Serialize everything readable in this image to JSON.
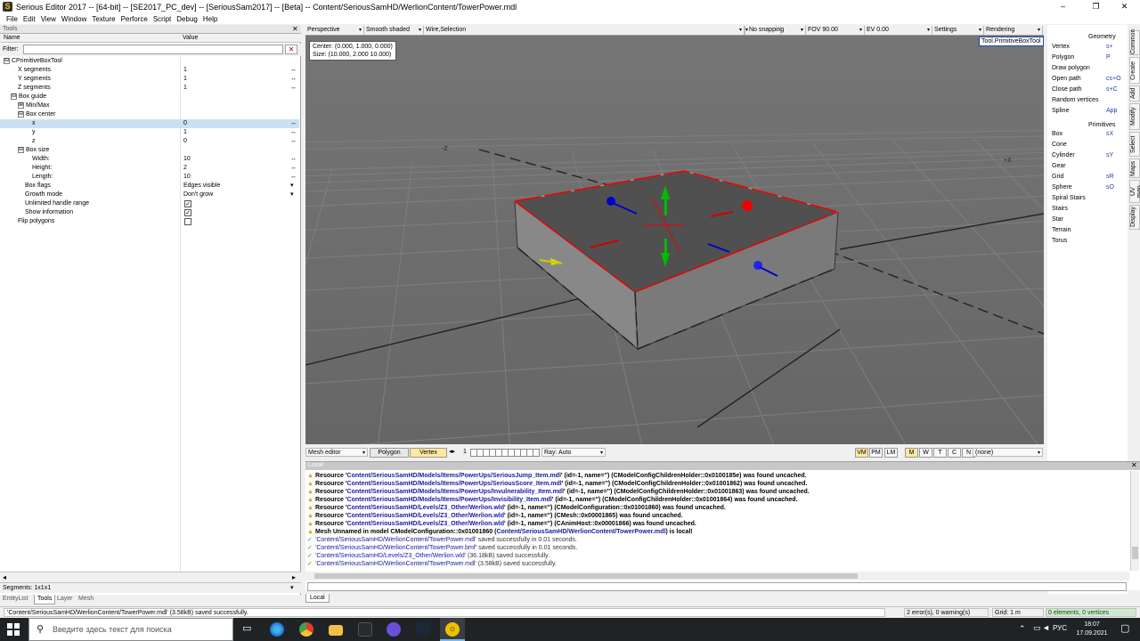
{
  "window": {
    "title": "Serious Editor 2017 -- [64-bit] -- [SE2017_PC_dev] -- [SeriousSam2017] -- [Beta] -- Content/SeriousSamHD/WerlionContent/TowerPower.mdl",
    "minimize": "–",
    "maximize": "❐",
    "close": "✕"
  },
  "menu": [
    "File",
    "Edit",
    "View",
    "Window",
    "Texture",
    "Perforce",
    "Script",
    "Debug",
    "Help"
  ],
  "tools": {
    "title": "Tools",
    "close": "✕",
    "col_name": "Name",
    "col_value": "Value",
    "filter_label": "Filter:",
    "filter_value": "",
    "filter_clear": "✕",
    "rows": [
      {
        "name": "CPrimitiveBoxTool",
        "value": "",
        "exp": "⊟",
        "indent": 0
      },
      {
        "name": "X segments",
        "value": "1",
        "arrow": "↔",
        "indent": 2
      },
      {
        "name": "Y segments",
        "value": "1",
        "arrow": "↔",
        "indent": 2
      },
      {
        "name": "Z segments",
        "value": "1",
        "arrow": "↔",
        "indent": 2
      },
      {
        "name": "Box guide",
        "value": "",
        "exp": "⊟",
        "indent": 1
      },
      {
        "name": "Min/Max",
        "value": "",
        "exp": "⊞",
        "indent": 2
      },
      {
        "name": "Box center",
        "value": "",
        "exp": "⊟",
        "indent": 2
      },
      {
        "name": "x",
        "value": "0",
        "arrow": "↔",
        "indent": 4,
        "sel": true
      },
      {
        "name": "y",
        "value": "1",
        "arrow": "↔",
        "indent": 4
      },
      {
        "name": "z",
        "value": "0",
        "arrow": "↔",
        "indent": 4
      },
      {
        "name": "Box size",
        "value": "",
        "exp": "⊟",
        "indent": 2
      },
      {
        "name": "Width:",
        "value": "10",
        "arrow": "↔",
        "indent": 4
      },
      {
        "name": "Height:",
        "value": "2",
        "arrow": "↔",
        "indent": 4
      },
      {
        "name": "Length:",
        "value": "10",
        "arrow": "↔",
        "indent": 4
      },
      {
        "name": "Box flags",
        "value": "Edges visible",
        "arrow": "▾",
        "indent": 3
      },
      {
        "name": "Growth mode",
        "value": "Don't grow",
        "arrow": "▾",
        "indent": 3
      },
      {
        "name": "Unlimited handle range",
        "value": "",
        "check": true,
        "indent": 3
      },
      {
        "name": "Show information",
        "value": "",
        "check": true,
        "indent": 3
      },
      {
        "name": "Flip polygons",
        "value": "",
        "check": false,
        "indent": 2
      }
    ],
    "segments": "Segments: 1x1x1",
    "tabs": [
      "EntityList",
      "Tools",
      "Layer",
      "Mesh"
    ]
  },
  "viewport": {
    "toolbar": {
      "projection": "Perspective",
      "shading": "Smooth shaded",
      "wire": "Wire,Selection",
      "snapping": "No snapping",
      "fov": "FOV 90.00",
      "ev": "EV  0.00",
      "settings": "Settings",
      "rendering": "Rendering"
    },
    "info_center": "Center: (0.000, 1.000, 0.000)",
    "info_size": "Size: (10.000, 2.000 10.000)",
    "tool_label": "Tool.PrimitiveBoxTool",
    "axis_z": "-Z",
    "axis_x": "+X"
  },
  "mesh_toolbar": {
    "editor": "Mesh editor",
    "polygon": "Polygon",
    "vertex": "Vertex",
    "page": "1",
    "ray": "Ray: Auto",
    "modes": [
      "VM",
      "PM",
      "LM",
      "M",
      "W",
      "T",
      "C",
      "N"
    ],
    "none": "(none)"
  },
  "right_panel": {
    "geometry_title": "Geometry",
    "geometry": [
      {
        "label": "Vertex",
        "shortcut": "s+"
      },
      {
        "label": "Polygon",
        "shortcut": "P"
      },
      {
        "label": "Draw polygon",
        "shortcut": ""
      },
      {
        "label": "Open path",
        "shortcut": "cs+O"
      },
      {
        "label": "Close path",
        "shortcut": "s+C"
      },
      {
        "label": "Random vertices",
        "shortcut": ""
      },
      {
        "label": "Spline",
        "shortcut": "App"
      }
    ],
    "primitives_title": "Primitives",
    "primitives": [
      {
        "label": "Box",
        "shortcut": "sX"
      },
      {
        "label": "Cone",
        "shortcut": ""
      },
      {
        "label": "Cylinder",
        "shortcut": "sY"
      },
      {
        "label": "Gear",
        "shortcut": ""
      },
      {
        "label": "Grid",
        "shortcut": "sR"
      },
      {
        "label": "Sphere",
        "shortcut": "sO"
      },
      {
        "label": "Spiral Stairs",
        "shortcut": ""
      },
      {
        "label": "Stairs",
        "shortcut": ""
      },
      {
        "label": "Star",
        "shortcut": ""
      },
      {
        "label": "Terrain",
        "shortcut": ""
      },
      {
        "label": "Torus",
        "shortcut": ""
      }
    ],
    "tabs": [
      "Common",
      "Create",
      "Add",
      "Modify",
      "Select",
      "Maps",
      "UV map",
      "Display"
    ]
  },
  "log": {
    "title": "Local",
    "close": "✕",
    "lines": [
      {
        "type": "warn",
        "pre": "Resource '",
        "path": "Content/SeriousSamHD/Models/Items/PowerUps/SeriousJump_Item.mdl",
        "post": "' (id=-1, name='') (CModelConfigChildrenHolder::0x0100185e) was found uncached."
      },
      {
        "type": "warn",
        "pre": "Resource '",
        "path": "Content/SeriousSamHD/Models/Items/PowerUps/SeriousScore_Item.mdl",
        "post": "' (id=-1, name='') (CModelConfigChildrenHolder::0x01001862) was found uncached."
      },
      {
        "type": "warn",
        "pre": "Resource '",
        "path": "Content/SeriousSamHD/Models/Items/PowerUps/Invulnerability_Item.mdl",
        "post": "' (id=-1, name='') (CModelConfigChildrenHolder::0x01001863) was found uncached."
      },
      {
        "type": "warn",
        "pre": "Resource '",
        "path": "Content/SeriousSamHD/Models/Items/PowerUps/Invisibility_Item.mdl",
        "post": "' (id=-1, name='') (CModelConfigChildrenHolder::0x01001864) was found uncached."
      },
      {
        "type": "warn",
        "pre": "Resource '",
        "path": "Content/SeriousSamHD/Levels/Z3_Other/Werlion.wld",
        "post": "' (id=-1, name='') (CModelConfiguration::0x01001860) was found uncached."
      },
      {
        "type": "warn",
        "pre": "Resource '",
        "path": "Content/SeriousSamHD/Levels/Z3_Other/Werlion.wld",
        "post": "' (id=-1, name='') (CMesh::0x00001865) was found uncached."
      },
      {
        "type": "warn",
        "pre": "Resource '",
        "path": "Content/SeriousSamHD/Levels/Z3_Other/Werlion.wld",
        "post": "' (id=-1, name='') (CAnimHost::0x00001866) was found uncached."
      },
      {
        "type": "warn",
        "pre": "Mesh Unnamed in model CModelConfiguration::0x01001860 (",
        "path": "Content/SeriousSamHD/WerlionContent/TowerPower.mdl",
        "post": ") is local!"
      },
      {
        "type": "ok",
        "pre": "'",
        "path": "Content/SeriousSamHD/WerlionContent/TowerPower.mdl",
        "post": "' saved successfully in 0.01 seconds."
      },
      {
        "type": "ok",
        "pre": "'",
        "path": "Content/SeriousSamHD/WerlionContent/TowerPower.bmf",
        "post": "' saved successfully in 0.01 seconds."
      },
      {
        "type": "ok",
        "pre": "'",
        "path": "Content/SeriousSamHD/Levels/Z3_Other/Werlion.wld",
        "post": "' (36.18kB) saved successfully."
      },
      {
        "type": "ok",
        "pre": "'",
        "path": "Content/SeriousSamHD/WerlionContent/TowerPower.mdl",
        "post": "' (3.58kB) saved successfully."
      }
    ],
    "tab": "Local"
  },
  "status": {
    "message": "'Content/SeriousSamHD/WerlionContent/TowerPower.mdl' (3.58kB) saved successfully.",
    "errors": "2 error(s), 0 warning(s)",
    "grid": "Grid: 1 m",
    "elements": "0 elements, 0 vertices"
  },
  "taskbar": {
    "search_placeholder": "Введите здесь текст для поиска",
    "lang": "РУС",
    "time": "18:07",
    "date": "17.09.2021"
  }
}
